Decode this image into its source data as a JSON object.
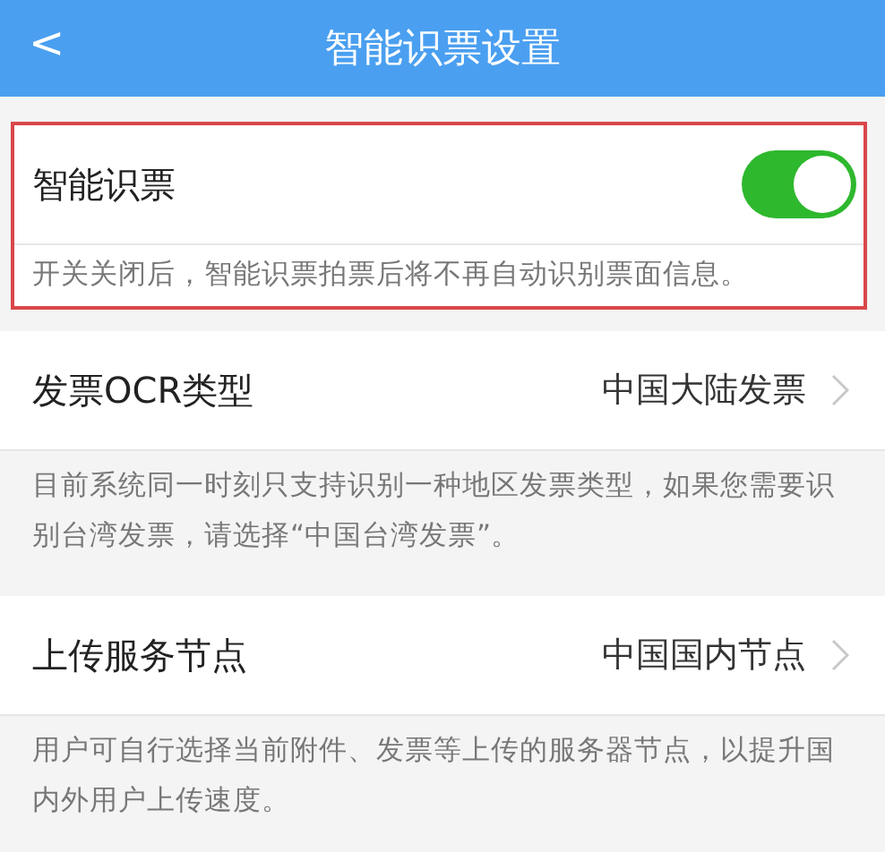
{
  "header": {
    "back": "<",
    "title": "智能识票设置"
  },
  "sections": [
    {
      "kind": "switch",
      "label": "智能识票",
      "on": true,
      "highlighted": true,
      "hint": "开关关闭后，智能识票拍票后将不再自动识别票面信息。"
    },
    {
      "kind": "select",
      "label": "发票OCR类型",
      "value": "中国大陆发票",
      "highlighted": false,
      "hint": "目前系统同一时刻只支持识别一种地区发票类型，如果您需要识别台湾发票，请选择“中国台湾发票”。"
    },
    {
      "kind": "select",
      "label": "上传服务节点",
      "value": "中国国内节点",
      "highlighted": false,
      "hint": "用户可自行选择当前附件、发票等上传的服务器节点，以提升国内外用户上传速度。"
    }
  ]
}
